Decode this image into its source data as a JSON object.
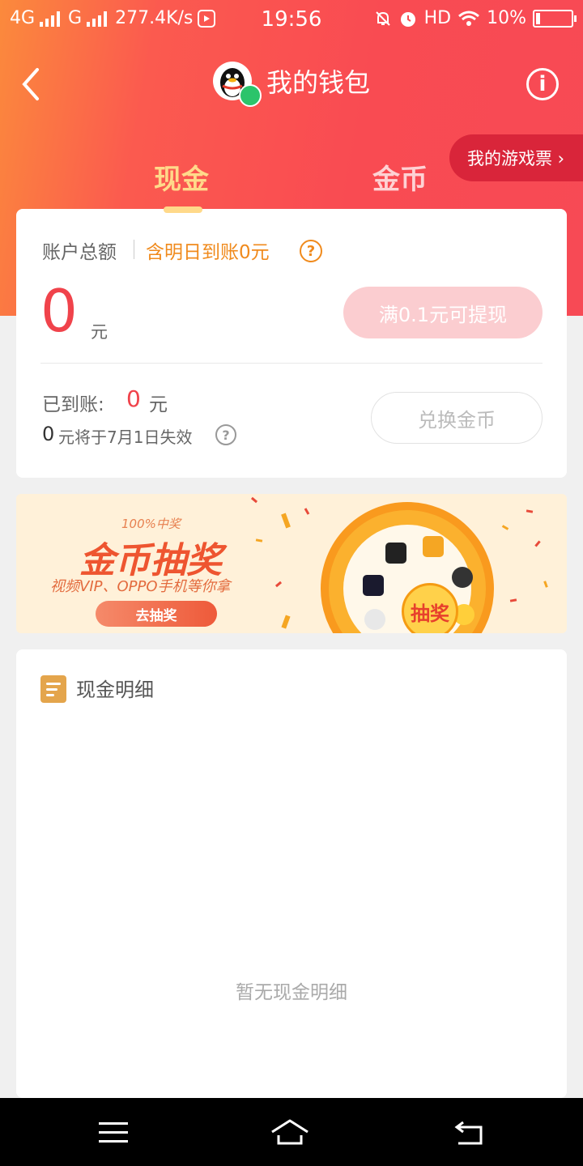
{
  "status_bar": {
    "network_left": "4G",
    "network_mid": "G",
    "speed": "277.4K/s",
    "time": "19:56",
    "hd": "HD",
    "battery": "10%",
    "battery_level": 0.1
  },
  "header": {
    "title": "我的钱包",
    "info_icon": "info-icon",
    "back_icon": "chevron-left-icon"
  },
  "tabs": [
    {
      "label": "现金",
      "active": true
    },
    {
      "label": "金币",
      "active": false
    }
  ],
  "game_ticket_button": "我的游戏票 ›",
  "cash_card": {
    "total_label": "账户总额",
    "pending_label": "含明日到账0元",
    "amount": "0",
    "amount_unit": "元",
    "withdraw_button": "满0.1元可提现",
    "arrived_label": "已到账:",
    "arrived_value": "0",
    "arrived_unit": "元",
    "expire_amount": "0",
    "expire_text": "元将于7月1日失效",
    "exchange_button": "兑换金币"
  },
  "banner": {
    "tagline": "100%中奖",
    "title": "金币抽奖",
    "subtitle": "视频VIP、OPPO手机等你拿",
    "button": "去抽奖",
    "wheel_center": "抽奖"
  },
  "detail": {
    "title": "现金明细",
    "empty_text": "暂无现金明细"
  },
  "colors": {
    "header_red": "#f94b52",
    "accent_gold": "#ffd98a",
    "amount_red": "#f0434b",
    "ticket_red": "#d9253a"
  }
}
